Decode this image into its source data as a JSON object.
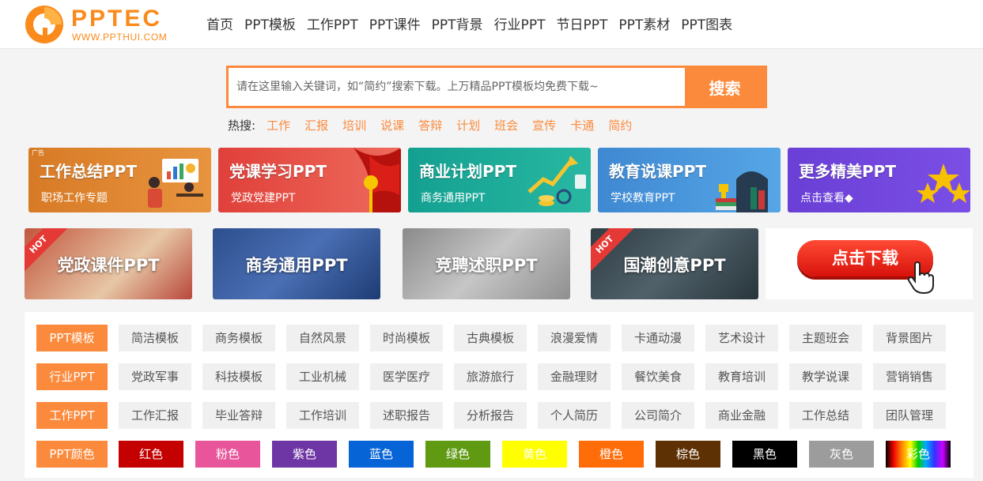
{
  "logo": {
    "name": "PPTEC",
    "url": "WWW.PPTHUI.COM"
  },
  "nav": [
    "首页",
    "PPT模板",
    "工作PPT",
    "PPT课件",
    "PPT背景",
    "行业PPT",
    "节日PPT",
    "PPT素材",
    "PPT图表"
  ],
  "search": {
    "placeholder": "请在这里输入关键词，如“简约”搜索下载。上万精品PPT模板均免费下载~",
    "button": "搜索"
  },
  "hot": {
    "label": "热搜:",
    "words": [
      "工作",
      "汇报",
      "培训",
      "说课",
      "答辩",
      "计划",
      "班会",
      "宣传",
      "卡通",
      "简约"
    ]
  },
  "banners_top": [
    {
      "title": "工作总结PPT",
      "sub": "职场工作专题",
      "badge": "广告",
      "color": "#d9832e",
      "icon": "presentation-illustration"
    },
    {
      "title": "党课学习PPT",
      "sub": "党政党建PPT",
      "color": "#e0403a",
      "icon": "red-flag-illustration"
    },
    {
      "title": "商业计划PPT",
      "sub": "商务通用PPT",
      "color": "#1aa99a",
      "icon": "growth-chart-illustration"
    },
    {
      "title": "教育说课PPT",
      "sub": "学校教育PPT",
      "color": "#3d8fd6",
      "icon": "books-trophy-illustration"
    },
    {
      "title": "更多精美PPT",
      "sub": "点击查看◆",
      "color": "#6b3fd6",
      "icon": "stars-illustration"
    }
  ],
  "banners_bottom": [
    {
      "title": "党政课件PPT",
      "hot": "HOT",
      "color": "#b84a3c"
    },
    {
      "title": "商务通用PPT",
      "color": "#2c4d8c"
    },
    {
      "title": "竞聘述职PPT",
      "color": "#a8a8a8"
    },
    {
      "title": "国潮创意PPT",
      "hot": "HOT",
      "color": "#37444a"
    }
  ],
  "download": {
    "label": "点击下载"
  },
  "categories": [
    {
      "head": "PPT模板",
      "items": [
        "简洁模板",
        "商务模板",
        "自然风景",
        "时尚模板",
        "古典模板",
        "浪漫爱情",
        "卡通动漫",
        "艺术设计",
        "主题班会",
        "背景图片"
      ]
    },
    {
      "head": "行业PPT",
      "items": [
        "党政军事",
        "科技模板",
        "工业机械",
        "医学医疗",
        "旅游旅行",
        "金融理财",
        "餐饮美食",
        "教育培训",
        "教学说课",
        "营销销售"
      ]
    },
    {
      "head": "工作PPT",
      "items": [
        "工作汇报",
        "毕业答辩",
        "工作培训",
        "述职报告",
        "分析报告",
        "个人简历",
        "公司简介",
        "商业金融",
        "工作总结",
        "团队管理"
      ]
    }
  ],
  "colors": {
    "head": "PPT颜色",
    "items": [
      {
        "label": "红色",
        "color": "#c40000",
        "text": "#ffffff"
      },
      {
        "label": "粉色",
        "color": "#e8559a",
        "text": "#ffffff"
      },
      {
        "label": "紫色",
        "color": "#6e35a4",
        "text": "#ffffff"
      },
      {
        "label": "蓝色",
        "color": "#0764d6",
        "text": "#ffffff"
      },
      {
        "label": "绿色",
        "color": "#5f9a12",
        "text": "#ffffff"
      },
      {
        "label": "黄色",
        "color": "#ffff00",
        "text": "#ffffff"
      },
      {
        "label": "橙色",
        "color": "#ff6d0a",
        "text": "#ffffff"
      },
      {
        "label": "棕色",
        "color": "#5e3104",
        "text": "#ffffff"
      },
      {
        "label": "黑色",
        "color": "#000000",
        "text": "#ffffff"
      },
      {
        "label": "灰色",
        "color": "#9c9c9c",
        "text": "#ffffff"
      },
      {
        "label": "彩色",
        "color": "rainbow",
        "text": "#ffffff"
      }
    ]
  },
  "accent": "#fb8a3c"
}
